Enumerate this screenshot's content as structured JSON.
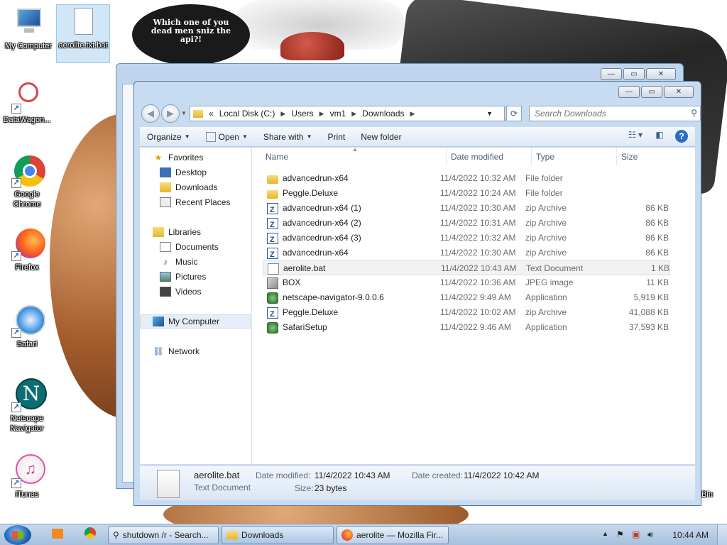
{
  "wallpaper": {
    "speech_bubble": "Which one of you dead men sniz the api?!"
  },
  "desktop_icons": [
    {
      "label": "My Computer"
    },
    {
      "label": "aerolite.txt.bat"
    },
    {
      "label": "DataWagon..."
    },
    {
      "label": "Google Chrome"
    },
    {
      "label": "Firefox"
    },
    {
      "label": "Safari"
    },
    {
      "label": "Netscape Navigator"
    },
    {
      "label": "iTunes"
    },
    {
      "label": "Bin"
    }
  ],
  "window": {
    "breadcrumb": [
      "Local Disk (C:)",
      "Users",
      "vm1",
      "Downloads"
    ],
    "breadcrumb_prefix": "«",
    "search_placeholder": "Search Downloads",
    "toolbar": {
      "organize": "Organize",
      "open": "Open",
      "share_with": "Share with",
      "print": "Print",
      "new_folder": "New folder"
    },
    "nav": {
      "favorites": "Favorites",
      "desktop": "Desktop",
      "downloads": "Downloads",
      "recent_places": "Recent Places",
      "libraries": "Libraries",
      "documents": "Documents",
      "music": "Music",
      "pictures": "Pictures",
      "videos": "Videos",
      "my_computer": "My Computer",
      "network": "Network"
    },
    "columns": {
      "name": "Name",
      "date": "Date modified",
      "type": "Type",
      "size": "Size"
    },
    "files": [
      {
        "name": "advancedrun-x64",
        "date": "11/4/2022 10:32 AM",
        "type": "File folder",
        "size": "",
        "icon": "folder-icon"
      },
      {
        "name": "Peggle.Deluxe",
        "date": "11/4/2022 10:24 AM",
        "type": "File folder",
        "size": "",
        "icon": "folder-icon"
      },
      {
        "name": "advancedrun-x64 (1)",
        "date": "11/4/2022 10:30 AM",
        "type": "zip Archive",
        "size": "86 KB",
        "icon": "zip-icon"
      },
      {
        "name": "advancedrun-x64 (2)",
        "date": "11/4/2022 10:31 AM",
        "type": "zip Archive",
        "size": "86 KB",
        "icon": "zip-icon"
      },
      {
        "name": "advancedrun-x64 (3)",
        "date": "11/4/2022 10:32 AM",
        "type": "zip Archive",
        "size": "86 KB",
        "icon": "zip-icon"
      },
      {
        "name": "advancedrun-x64",
        "date": "11/4/2022 10:30 AM",
        "type": "zip Archive",
        "size": "86 KB",
        "icon": "zip-icon"
      },
      {
        "name": "aerolite.bat",
        "date": "11/4/2022 10:43 AM",
        "type": "Text Document",
        "size": "1 KB",
        "icon": "text-document-icon"
      },
      {
        "name": "BOX",
        "date": "11/4/2022 10:36 AM",
        "type": "JPEG image",
        "size": "11 KB",
        "icon": "image-icon"
      },
      {
        "name": "netscape-navigator-9.0.0.6",
        "date": "11/4/2022 9:49 AM",
        "type": "Application",
        "size": "5,919 KB",
        "icon": "application-icon"
      },
      {
        "name": "Peggle.Deluxe",
        "date": "11/4/2022 10:02 AM",
        "type": "zip Archive",
        "size": "41,088 KB",
        "icon": "zip-icon"
      },
      {
        "name": "SafariSetup",
        "date": "11/4/2022 9:46 AM",
        "type": "Application",
        "size": "37,593 KB",
        "icon": "application-icon"
      }
    ],
    "details": {
      "filename": "aerolite.bat",
      "filetype": "Text Document",
      "date_modified_label": "Date modified:",
      "date_modified": "11/4/2022 10:43 AM",
      "date_created_label": "Date created:",
      "date_created": "11/4/2022 10:42 AM",
      "size_label": "Size:",
      "size": "23 bytes"
    }
  },
  "taskbar": {
    "buttons": [
      {
        "label": "shutdown /r - Search..."
      },
      {
        "label": "Downloads"
      },
      {
        "label": "aerolite — Mozilla Fir..."
      }
    ],
    "clock": "10:44 AM"
  }
}
